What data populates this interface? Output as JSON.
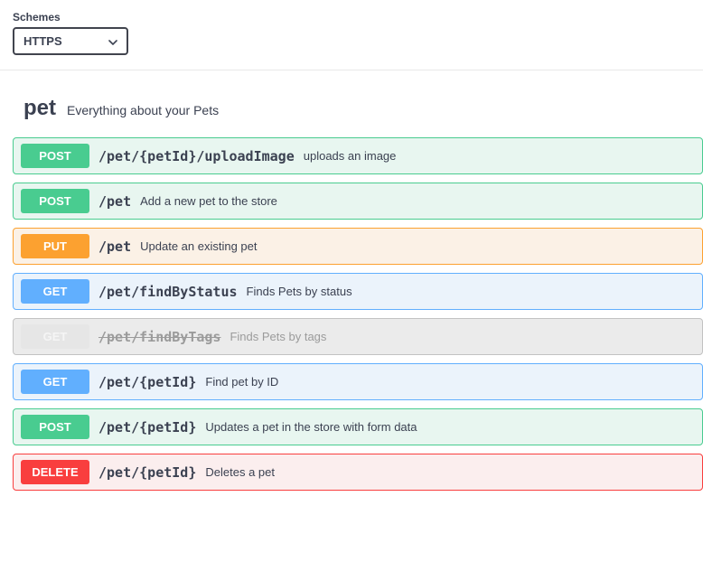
{
  "schemes": {
    "label": "Schemes",
    "selected": "HTTPS"
  },
  "tag": {
    "name": "pet",
    "description": "Everything about your Pets"
  },
  "operations": [
    {
      "method": "POST",
      "methodClass": "m-post",
      "opClass": "op-post",
      "path": "/pet/{petId}/uploadImage",
      "summary": "uploads an image",
      "deprecated": false
    },
    {
      "method": "POST",
      "methodClass": "m-post",
      "opClass": "op-post",
      "path": "/pet",
      "summary": "Add a new pet to the store",
      "deprecated": false
    },
    {
      "method": "PUT",
      "methodClass": "m-put",
      "opClass": "op-put",
      "path": "/pet",
      "summary": "Update an existing pet",
      "deprecated": false
    },
    {
      "method": "GET",
      "methodClass": "m-get",
      "opClass": "op-get",
      "path": "/pet/findByStatus",
      "summary": "Finds Pets by status",
      "deprecated": false
    },
    {
      "method": "GET",
      "methodClass": "m-deprecated",
      "opClass": "op-deprecated",
      "path": "/pet/findByTags",
      "summary": "Finds Pets by tags",
      "deprecated": true
    },
    {
      "method": "GET",
      "methodClass": "m-get",
      "opClass": "op-get",
      "path": "/pet/{petId}",
      "summary": "Find pet by ID",
      "deprecated": false
    },
    {
      "method": "POST",
      "methodClass": "m-post",
      "opClass": "op-post",
      "path": "/pet/{petId}",
      "summary": "Updates a pet in the store with form data",
      "deprecated": false
    },
    {
      "method": "DELETE",
      "methodClass": "m-delete",
      "opClass": "op-delete",
      "path": "/pet/{petId}",
      "summary": "Deletes a pet",
      "deprecated": false
    }
  ]
}
